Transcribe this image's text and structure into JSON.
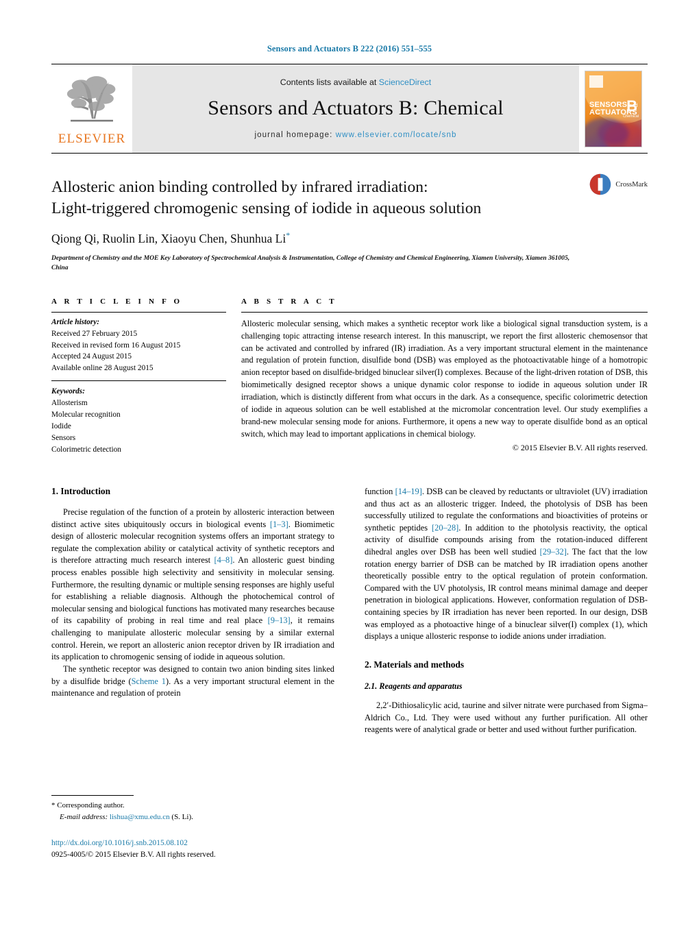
{
  "running_head": "Sensors and Actuators B 222 (2016) 551–555",
  "masthead": {
    "publisher_logo_label": "ELSEVIER",
    "contents_prefix": "Contents lists available at ",
    "contents_link": "ScienceDirect",
    "journal_name": "Sensors and Actuators B: Chemical",
    "homepage_prefix": "journal homepage: ",
    "homepage_url": "www.elsevier.com/locate/snb",
    "cover": {
      "line1": "SENSORS",
      "line1_small": "and",
      "line2": "ACTUATORS",
      "volume_letter": "B",
      "volume_sub": "Chemical"
    }
  },
  "article": {
    "title_line1": "Allosteric anion binding controlled by infrared irradiation:",
    "title_line2": "Light-triggered chromogenic sensing of iodide in aqueous solution",
    "authors": "Qiong Qi, Ruolin Lin, Xiaoyu Chen, Shunhua Li",
    "corresponding_marker": "*",
    "affiliation": "Department of Chemistry and the MOE Key Laboratory of Spectrochemical Analysis & Instrumentation, College of Chemistry and Chemical Engineering, Xiamen University, Xiamen 361005, China",
    "crossmark_label": "CrossMark"
  },
  "article_info": {
    "heading": "A R T I C L E   I N F O",
    "history_label": "Article history:",
    "history": [
      "Received 27 February 2015",
      "Received in revised form 16 August 2015",
      "Accepted 24 August 2015",
      "Available online 28 August 2015"
    ],
    "keywords_label": "Keywords:",
    "keywords": [
      "Allosterism",
      "Molecular recognition",
      "Iodide",
      "Sensors",
      "Colorimetric detection"
    ]
  },
  "abstract": {
    "heading": "A B S T R A C T",
    "text": "Allosteric molecular sensing, which makes a synthetic receptor work like a biological signal transduction system, is a challenging topic attracting intense research interest. In this manuscript, we report the first allosteric chemosensor that can be activated and controlled by infrared (IR) irradiation. As a very important structural element in the maintenance and regulation of protein function, disulfide bond (DSB) was employed as the photoactivatable hinge of a homotropic anion receptor based on disulfide-bridged binuclear silver(I) complexes. Because of the light-driven rotation of DSB, this biomimetically designed receptor shows a unique dynamic color response to iodide in aqueous solution under IR irradiation, which is distinctly different from what occurs in the dark. As a consequence, specific colorimetric detection of iodide in aqueous solution can be well established at the micromolar concentration level. Our study exemplifies a brand-new molecular sensing mode for anions. Furthermore, it opens a new way to operate disulfide bond as an optical switch, which may lead to important applications in chemical biology.",
    "copyright": "© 2015 Elsevier B.V. All rights reserved."
  },
  "sections": {
    "introduction_heading": "1. Introduction",
    "intro_p1_a": "Precise regulation of the function of a protein by allosteric interaction between distinct active sites ubiquitously occurs in biological events ",
    "intro_p1_ref1": "[1–3]",
    "intro_p1_b": ". Biomimetic design of allosteric molecular recognition systems offers an important strategy to regulate the complexation ability or catalytical activity of synthetic receptors and is therefore attracting much research interest ",
    "intro_p1_ref2": "[4–8]",
    "intro_p1_c": ". An allosteric guest binding process enables possible high selectivity and sensitivity in molecular sensing. Furthermore, the resulting dynamic or multiple sensing responses are highly useful for establishing a reliable diagnosis. Although the photochemical control of molecular sensing and biological functions has motivated many researches because of its capability of probing in real time and real place ",
    "intro_p1_ref3": "[9–13]",
    "intro_p1_d": ", it remains challenging to manipulate allosteric molecular sensing by a similar external control. Herein, we report an allosteric anion receptor driven by IR irradiation and its application to chromogenic sensing of iodide in aqueous solution.",
    "intro_p2_a": "The synthetic receptor was designed to contain two anion binding sites linked by a disulfide bridge (",
    "intro_p2_scheme": "Scheme 1",
    "intro_p2_b": "). As a very important structural element in the maintenance and regulation of protein",
    "intro_p3_a": "function ",
    "intro_p3_ref1": "[14–19]",
    "intro_p3_b": ". DSB can be cleaved by reductants or ultraviolet (UV) irradiation and thus act as an allosteric trigger. Indeed, the photolysis of DSB has been successfully utilized to regulate the conformations and bioactivities of proteins or synthetic peptides ",
    "intro_p3_ref2": "[20–28]",
    "intro_p3_c": ". In addition to the photolysis reactivity, the optical activity of disulfide compounds arising from the rotation-induced different dihedral angles over DSB has been well studied ",
    "intro_p3_ref3": "[29–32]",
    "intro_p3_d": ". The fact that the low rotation energy barrier of DSB can be matched by IR irradiation opens another theoretically possible entry to the optical regulation of protein conformation. Compared with the UV photolysis, IR control means minimal damage and deeper penetration in biological applications. However, conformation regulation of DSB-containing species by IR irradiation has never been reported. In our design, DSB was employed as a photoactive hinge of a binuclear silver(I) complex (1), which displays a unique allosteric response to iodide anions under irradiation.",
    "materials_heading": "2. Materials and methods",
    "reagents_heading": "2.1. Reagents and apparatus",
    "reagents_text": "2,2′-Dithiosalicylic acid, taurine and silver nitrate were purchased from Sigma–Aldrich Co., Ltd. They were used without any further purification. All other reagents were of analytical grade or better and used without further purification."
  },
  "footer": {
    "corresponding_marker": "*",
    "corresponding_label": "Corresponding author.",
    "email_label": "E-mail address:",
    "email": "lishua@xmu.edu.cn",
    "email_suffix": "(S. Li).",
    "doi_url": "http://dx.doi.org/10.1016/j.snb.2015.08.102",
    "issn_line": "0925-4005/© 2015 Elsevier B.V. All rights reserved."
  },
  "colors": {
    "link_blue": "#1a7aa8",
    "sciencedirect_blue": "#2f8fc4",
    "elsevier_orange": "#e87722"
  }
}
